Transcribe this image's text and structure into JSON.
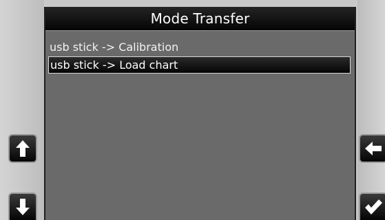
{
  "window": {
    "title": "Mode Transfer"
  },
  "list": {
    "items": [
      {
        "label": "usb stick -> Calibration",
        "selected": false
      },
      {
        "label": "usb stick -> Load chart",
        "selected": true
      }
    ]
  },
  "buttons": {
    "up": {
      "icon": "arrow-up-icon"
    },
    "down": {
      "icon": "arrow-down-icon"
    },
    "back": {
      "icon": "arrow-left-icon"
    },
    "confirm": {
      "icon": "checkmark-icon"
    }
  },
  "colors": {
    "screen_bg": "#6a6a6a",
    "title_bg": "#050505",
    "selected_bg": "#050505",
    "text": "#ffffff",
    "bezel": "#c9c9c9"
  }
}
